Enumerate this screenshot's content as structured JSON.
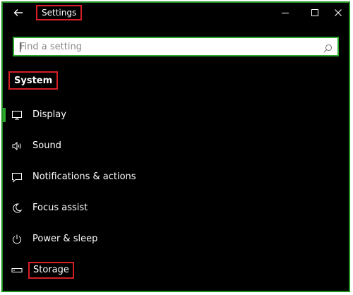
{
  "window": {
    "title": "Settings"
  },
  "search": {
    "placeholder": "Find a setting"
  },
  "section": {
    "title": "System"
  },
  "nav": {
    "items": [
      {
        "label": "Display",
        "icon": "monitor-icon",
        "selected": true
      },
      {
        "label": "Sound",
        "icon": "speaker-icon",
        "selected": false
      },
      {
        "label": "Notifications & actions",
        "icon": "notification-icon",
        "selected": false
      },
      {
        "label": "Focus assist",
        "icon": "moon-icon",
        "selected": false
      },
      {
        "label": "Power & sleep",
        "icon": "power-icon",
        "selected": false
      },
      {
        "label": "Storage",
        "icon": "storage-icon",
        "selected": false
      }
    ]
  },
  "colors": {
    "background": "#000000",
    "text": "#ffffff",
    "accent": "#2ba82b",
    "highlight_box": "#d51f26",
    "window_border": "#1f8f1f"
  }
}
